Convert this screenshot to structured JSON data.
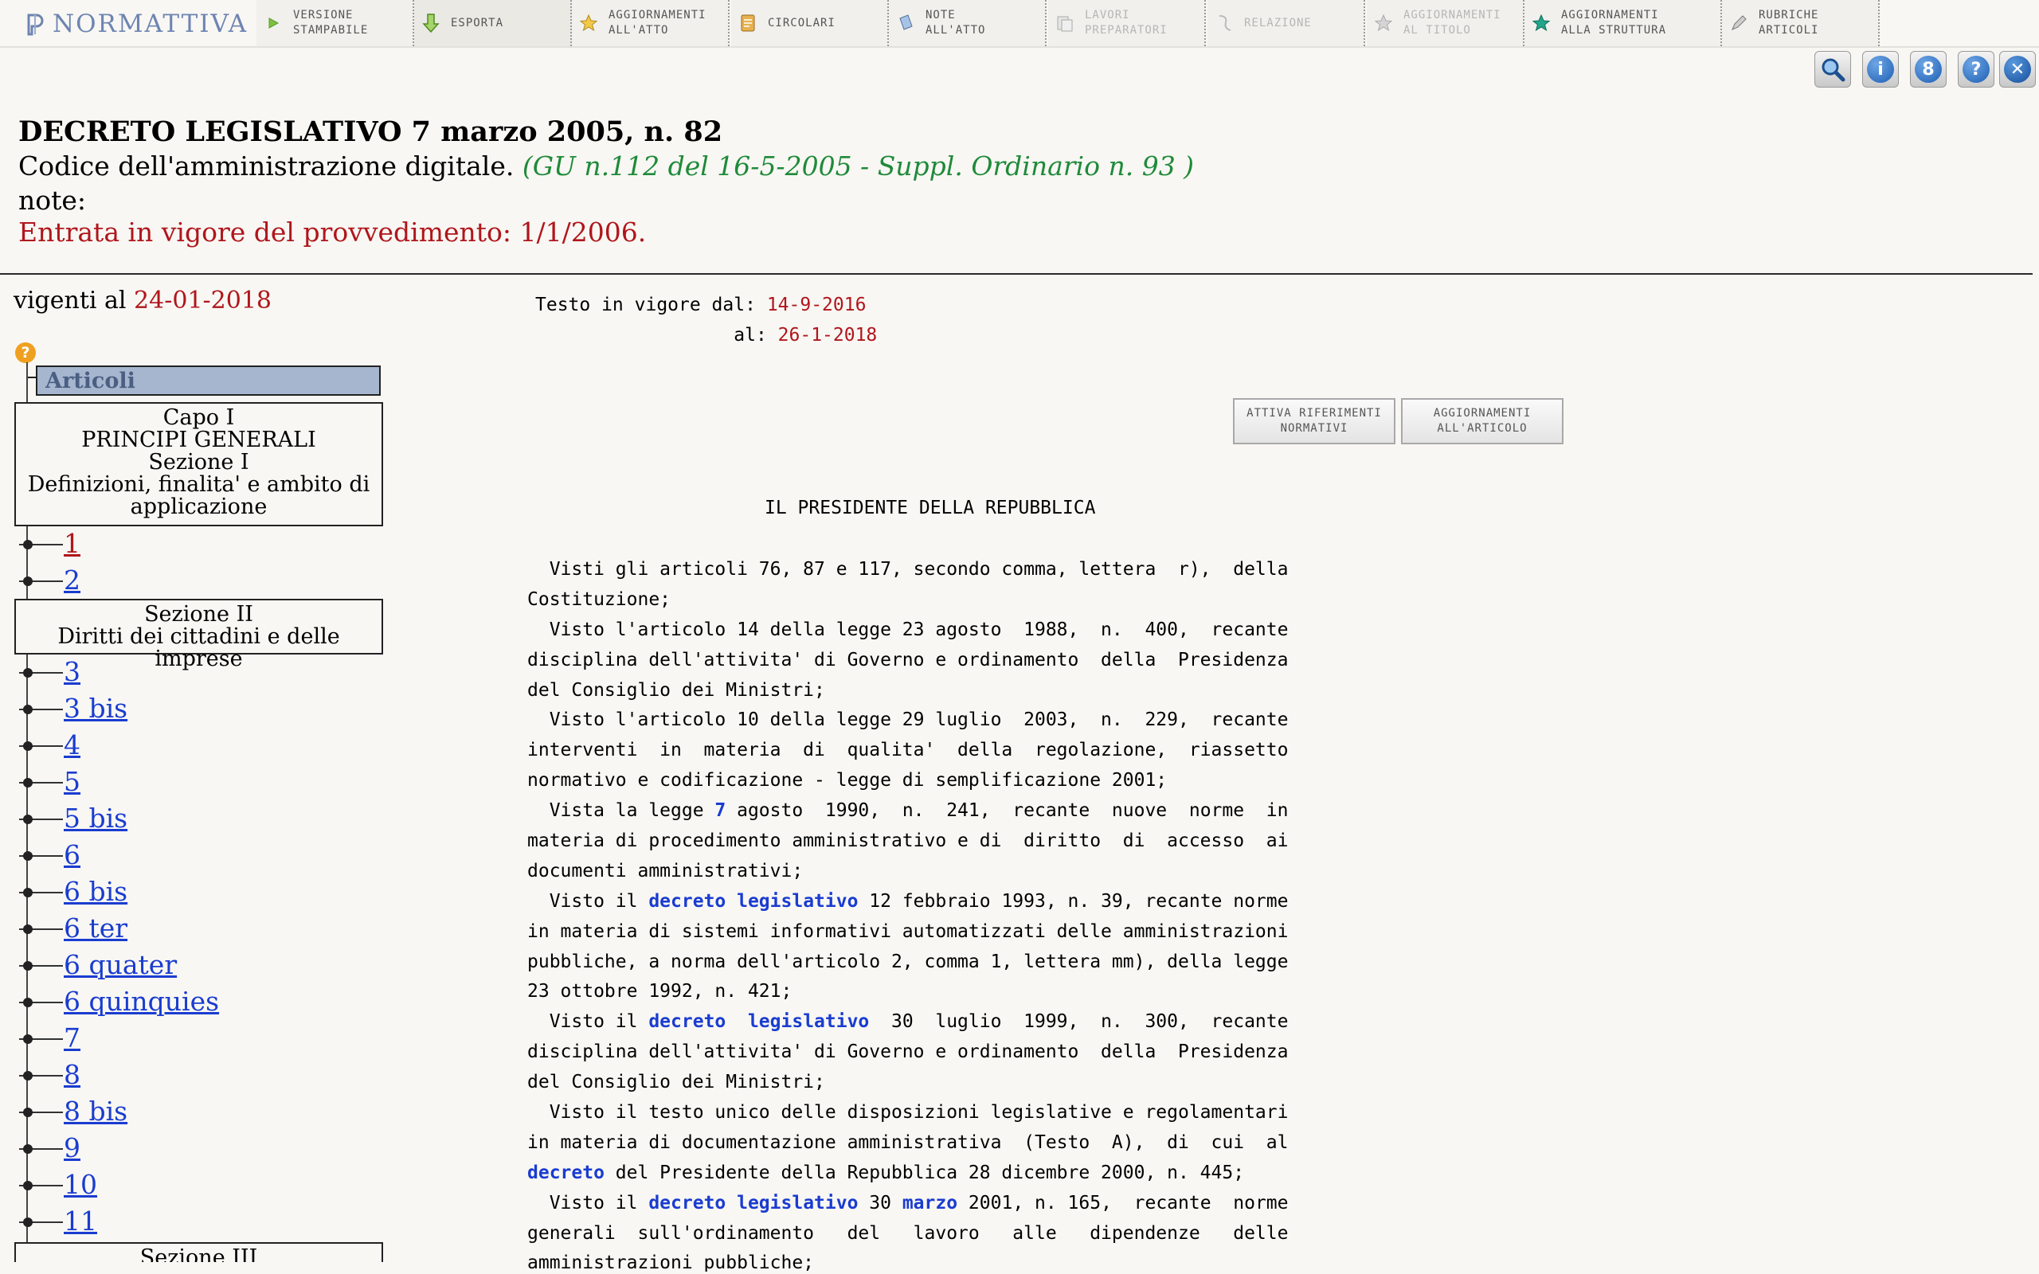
{
  "brand": "NORMATTIVA",
  "toolbar": [
    {
      "label": "VERSIONE\nSTAMPABILE",
      "icon": "play-icon",
      "disabled": false,
      "selected": false
    },
    {
      "label": "ESPORTA",
      "icon": "download-arrow-icon",
      "disabled": false,
      "selected": true
    },
    {
      "label": "AGGIORNAMENTI\nALL'ATTO",
      "icon": "star-icon",
      "disabled": false,
      "selected": false
    },
    {
      "label": "CIRCOLARI",
      "icon": "document-icon",
      "disabled": false,
      "selected": false
    },
    {
      "label": "NOTE\nALL'ATTO",
      "icon": "note-icon",
      "disabled": false,
      "selected": false
    },
    {
      "label": "LAVORI\nPREPARATORI",
      "icon": "documents-icon",
      "disabled": true,
      "selected": false
    },
    {
      "label": "RELAZIONE",
      "icon": "paper-icon",
      "disabled": true,
      "selected": false
    },
    {
      "label": "AGGIORNAMENTI\nAL TITOLO",
      "icon": "star-gray-icon",
      "disabled": true,
      "selected": false
    },
    {
      "label": "AGGIORNAMENTI\nALLA STRUTTURA",
      "icon": "star-teal-icon",
      "disabled": false,
      "selected": false
    },
    {
      "label": "RUBRICHE\nARTICOLI",
      "icon": "pencil-icon",
      "disabled": false,
      "selected": false
    }
  ],
  "right_icons": [
    {
      "name": "search-zoom-icon",
      "glyph": ""
    },
    {
      "name": "info-icon",
      "glyph": "i"
    },
    {
      "name": "link-icon",
      "glyph": "8"
    },
    {
      "name": "help-icon",
      "glyph": "?"
    },
    {
      "name": "close-icon",
      "glyph": "✕"
    }
  ],
  "header": {
    "title": "DECRETO LEGISLATIVO 7 marzo 2005, n. 82",
    "subtitle": "Codice dell'amministrazione digitale.",
    "gazette": "(GU n.112 del 16-5-2005 - Suppl. Ordinario n. 93 )",
    "notes_label": "note:",
    "entry_into_force": "Entrata in vigore del provvedimento: 1/1/2006."
  },
  "sidebar": {
    "vigenti_label": "vigenti al",
    "vigenti_date": "24-01-2018",
    "articles_header": "Articoli",
    "capo": {
      "lines": [
        "Capo I",
        "PRINCIPI GENERALI",
        "Sezione I",
        "Definizioni, finalita' e ambito di applicazione"
      ]
    },
    "group1": [
      "1",
      "2"
    ],
    "sezione2": {
      "lines": [
        "Sezione II",
        "Diritti dei cittadini e delle imprese"
      ]
    },
    "group2": [
      "3",
      "3 bis",
      "4",
      "5",
      "5 bis",
      "6",
      "6 bis",
      "6 ter",
      "6 quater",
      "6 quinquies",
      "7",
      "8",
      "8 bis",
      "9",
      "10",
      "11"
    ],
    "sezione3": {
      "lines": [
        "Sezione III"
      ]
    }
  },
  "main": {
    "vigore_label": "Testo in vigore dal:",
    "vigore_from": "14-9-2016",
    "vigore_to_label": "al:",
    "vigore_to": "26-1-2018",
    "btn_riferimenti": "ATTIVA RIFERIMENTI\nNORMATIVI",
    "btn_aggiornamenti": "AGGIORNAMENTI\nALL'ARTICOLO",
    "heading": "IL PRESIDENTE DELLA REPUBBLICA",
    "lines": [
      [
        {
          "t": "  Visti gli articoli 76, 87 e 117, secondo comma, lettera  r),  della"
        }
      ],
      [
        {
          "t": "Costituzione;"
        }
      ],
      [
        {
          "t": "  Visto l'articolo 14 della legge 23 agosto  1988,  n.  400,  recante"
        }
      ],
      [
        {
          "t": "disciplina dell'attivita' di Governo e ordinamento  della  Presidenza"
        }
      ],
      [
        {
          "t": "del Consiglio dei Ministri;"
        }
      ],
      [
        {
          "t": "  Visto l'articolo 10 della legge 29 luglio  2003,  n.  229,  recante"
        }
      ],
      [
        {
          "t": "interventi  in  materia  di  qualita'  della  regolazione,  riassetto"
        }
      ],
      [
        {
          "t": "normativo e codificazione - legge di semplificazione 2001;"
        }
      ],
      [
        {
          "t": "  Vista la legge "
        },
        {
          "t": "7",
          "k": true
        },
        {
          "t": " agosto  1990,  n.  241,  recante  nuove  norme  in"
        }
      ],
      [
        {
          "t": "materia di procedimento amministrativo e di  diritto  di  accesso  ai"
        }
      ],
      [
        {
          "t": "documenti amministrativi;"
        }
      ],
      [
        {
          "t": "  Visto il "
        },
        {
          "t": "decreto legislativo",
          "k": true
        },
        {
          "t": " 12 febbraio 1993, n. 39, recante norme"
        }
      ],
      [
        {
          "t": "in materia di sistemi informativi automatizzati delle amministrazioni"
        }
      ],
      [
        {
          "t": "pubbliche, a norma dell'articolo 2, comma 1, lettera mm), della legge"
        }
      ],
      [
        {
          "t": "23 ottobre 1992, n. 421;"
        }
      ],
      [
        {
          "t": "  Visto il "
        },
        {
          "t": "decreto  legislativo",
          "k": true
        },
        {
          "t": "  30  luglio  1999,  n.  300,  recante"
        }
      ],
      [
        {
          "t": "disciplina dell'attivita' di Governo e ordinamento  della  Presidenza"
        }
      ],
      [
        {
          "t": "del Consiglio dei Ministri;"
        }
      ],
      [
        {
          "t": "  Visto il testo unico delle disposizioni legislative e regolamentari"
        }
      ],
      [
        {
          "t": "in materia di documentazione amministrativa  (Testo  A),  di  cui  al"
        }
      ],
      [
        {
          "t": "decreto",
          "k": true
        },
        {
          "t": " del Presidente della Repubblica 28 dicembre 2000, n. 445;"
        }
      ],
      [
        {
          "t": "  Visto il "
        },
        {
          "t": "decreto legislativo",
          "k": true
        },
        {
          "t": " 30 "
        },
        {
          "t": "marzo",
          "k": true
        },
        {
          "t": " 2001, n. 165,  recante  norme"
        }
      ],
      [
        {
          "t": "generali  sull'ordinamento   del   lavoro   alle   dipendenze   delle"
        }
      ],
      [
        {
          "t": "amministrazioni pubbliche;"
        }
      ]
    ]
  },
  "colors": {
    "accent_red": "#b0161c",
    "link_blue": "#1a3cd0",
    "gazette_green": "#1f8a3a",
    "articles_header_bg": "#a6b6cf"
  }
}
